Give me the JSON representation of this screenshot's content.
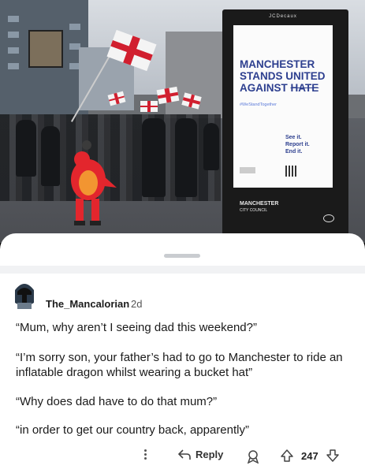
{
  "post_image": {
    "billboard": {
      "brand": "JCDecaux",
      "headline_line1": "MANCHESTER",
      "headline_line2": "STANDS UNITED",
      "headline_line3a": "AGAINST ",
      "headline_line3b": "HATE",
      "hashtag": "#WeStandTogether",
      "cta1": "See it.",
      "cta2": "Report it.",
      "cta3": "End it."
    },
    "council_name": "MANCHESTER",
    "council_sub": "CITY COUNCIL"
  },
  "comment": {
    "username": "The_Mancalorian",
    "age": "2d",
    "paragraphs": [
      "“Mum, why aren’t I seeing dad this weekend?”",
      "“I’m sorry son, your father’s had to go to Manchester to ride an inflatable dragon whilst wearing a bucket hat”",
      "“Why does dad have to do that mum?”",
      "“in order to get our country back, apparently”"
    ],
    "actions": {
      "reply_label": "Reply",
      "score": "247"
    }
  },
  "colors": {
    "ad_text": "#2d3f8f",
    "flag_red": "#d11f2f"
  },
  "icons": [
    "more-options-icon",
    "reply-icon",
    "award-icon",
    "upvote-icon",
    "downvote-icon"
  ]
}
